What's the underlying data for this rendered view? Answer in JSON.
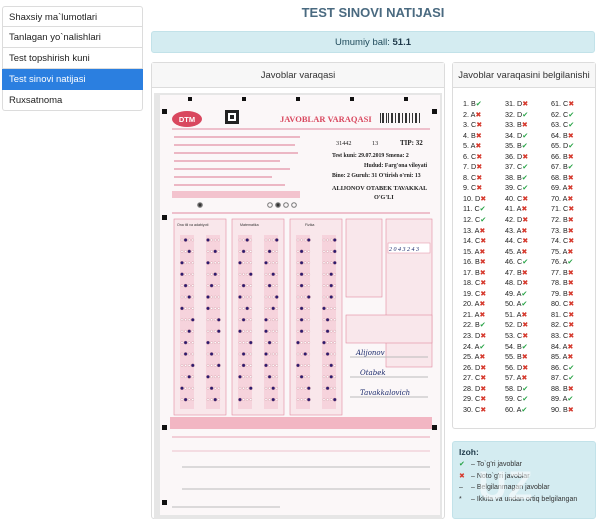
{
  "sidebar": {
    "items": [
      {
        "label": "Shaxsiy ma`lumotlari",
        "active": false
      },
      {
        "label": "Tanlagan yo`nalishlari",
        "active": false
      },
      {
        "label": "Test topshirish kuni",
        "active": false
      },
      {
        "label": "Test sinovi natijasi",
        "active": true
      },
      {
        "label": "Ruxsatnoma",
        "active": false
      }
    ]
  },
  "page_title": "TEST SINOVI NATIJASI",
  "score": {
    "label": "Umumiy ball:",
    "value": "51.1"
  },
  "sheet_panel": {
    "title": "Javoblar varaqasi",
    "sheet": {
      "logo": "DTM",
      "heading": "JAVOBLAR VARAQASI",
      "id_number": "31442",
      "variant": "13",
      "tip": "TIP: 32",
      "test_date_label": "Test kuni:",
      "test_date": "29.07.2019",
      "shift_label": "Smena:",
      "shift": "2",
      "region_label": "Hudud:",
      "region": "Farg'ona viloyati",
      "building_label": "Bino:",
      "building": "2",
      "group_label": "Guruh:",
      "group": "31",
      "seat_label": "O'tirish o'rni:",
      "seat": "13",
      "name_line1": "ALIJONOV OTABEK TAVAKKAL",
      "name_line2": "O'G'LI",
      "subjects": [
        "Ona tili va adabiyoti",
        "Matematika",
        "Fizika"
      ],
      "handwritten": [
        "Alijonov",
        "Otabek",
        "Tavakkalovich"
      ],
      "written_code": "2 0 4 3 2 4 3"
    }
  },
  "key_panel": {
    "title": "Javoblar varaqasini belgilanishi",
    "answers": [
      {
        "n": "1.",
        "l": "B",
        "m": "ok"
      },
      {
        "n": "2.",
        "l": "A",
        "m": "x"
      },
      {
        "n": "3.",
        "l": "C",
        "m": "x"
      },
      {
        "n": "4.",
        "l": "B",
        "m": "x"
      },
      {
        "n": "5.",
        "l": "A",
        "m": "x"
      },
      {
        "n": "6.",
        "l": "C",
        "m": "x"
      },
      {
        "n": "7.",
        "l": "D",
        "m": "x"
      },
      {
        "n": "8.",
        "l": "C",
        "m": "x"
      },
      {
        "n": "9.",
        "l": "C",
        "m": "x"
      },
      {
        "n": "10.",
        "l": "D",
        "m": "x"
      },
      {
        "n": "11.",
        "l": "C",
        "m": "ok"
      },
      {
        "n": "12.",
        "l": "C",
        "m": "ok"
      },
      {
        "n": "13.",
        "l": "A",
        "m": "x"
      },
      {
        "n": "14.",
        "l": "C",
        "m": "x"
      },
      {
        "n": "15.",
        "l": "A",
        "m": "x"
      },
      {
        "n": "16.",
        "l": "B",
        "m": "x"
      },
      {
        "n": "17.",
        "l": "B",
        "m": "x"
      },
      {
        "n": "18.",
        "l": "C",
        "m": "x"
      },
      {
        "n": "19.",
        "l": "C",
        "m": "x"
      },
      {
        "n": "20.",
        "l": "A",
        "m": "x"
      },
      {
        "n": "21.",
        "l": "A",
        "m": "x"
      },
      {
        "n": "22.",
        "l": "B",
        "m": "ok"
      },
      {
        "n": "23.",
        "l": "D",
        "m": "x"
      },
      {
        "n": "24.",
        "l": "A",
        "m": "ok"
      },
      {
        "n": "25.",
        "l": "A",
        "m": "x"
      },
      {
        "n": "26.",
        "l": "D",
        "m": "x"
      },
      {
        "n": "27.",
        "l": "C",
        "m": "x"
      },
      {
        "n": "28.",
        "l": "D",
        "m": "x"
      },
      {
        "n": "29.",
        "l": "C",
        "m": "x"
      },
      {
        "n": "30.",
        "l": "C",
        "m": "x"
      },
      {
        "n": "31.",
        "l": "D",
        "m": "x"
      },
      {
        "n": "32.",
        "l": "D",
        "m": "ok"
      },
      {
        "n": "33.",
        "l": "B",
        "m": "x"
      },
      {
        "n": "34.",
        "l": "D",
        "m": "ok"
      },
      {
        "n": "35.",
        "l": "B",
        "m": "ok"
      },
      {
        "n": "36.",
        "l": "D",
        "m": "x"
      },
      {
        "n": "37.",
        "l": "C",
        "m": "ok"
      },
      {
        "n": "38.",
        "l": "B",
        "m": "ok"
      },
      {
        "n": "39.",
        "l": "C",
        "m": "ok"
      },
      {
        "n": "40.",
        "l": "C",
        "m": "x"
      },
      {
        "n": "41.",
        "l": "A",
        "m": "x"
      },
      {
        "n": "42.",
        "l": "D",
        "m": "x"
      },
      {
        "n": "43.",
        "l": "A",
        "m": "x"
      },
      {
        "n": "44.",
        "l": "C",
        "m": "x"
      },
      {
        "n": "45.",
        "l": "A",
        "m": "x"
      },
      {
        "n": "46.",
        "l": "C",
        "m": "ok"
      },
      {
        "n": "47.",
        "l": "B",
        "m": "x"
      },
      {
        "n": "48.",
        "l": "D",
        "m": "x"
      },
      {
        "n": "49.",
        "l": "A",
        "m": "ok"
      },
      {
        "n": "50.",
        "l": "A",
        "m": "ok"
      },
      {
        "n": "51.",
        "l": "A",
        "m": "x"
      },
      {
        "n": "52.",
        "l": "D",
        "m": "x"
      },
      {
        "n": "53.",
        "l": "C",
        "m": "x"
      },
      {
        "n": "54.",
        "l": "B",
        "m": "ok"
      },
      {
        "n": "55.",
        "l": "B",
        "m": "x"
      },
      {
        "n": "56.",
        "l": "D",
        "m": "x"
      },
      {
        "n": "57.",
        "l": "A",
        "m": "x"
      },
      {
        "n": "58.",
        "l": "D",
        "m": "ok"
      },
      {
        "n": "59.",
        "l": "C",
        "m": "ok"
      },
      {
        "n": "60.",
        "l": "A",
        "m": "ok"
      },
      {
        "n": "61.",
        "l": "C",
        "m": "x"
      },
      {
        "n": "62.",
        "l": "C",
        "m": "ok"
      },
      {
        "n": "63.",
        "l": "C",
        "m": "ok"
      },
      {
        "n": "64.",
        "l": "B",
        "m": "x"
      },
      {
        "n": "65.",
        "l": "D",
        "m": "ok"
      },
      {
        "n": "66.",
        "l": "B",
        "m": "x"
      },
      {
        "n": "67.",
        "l": "B",
        "m": "ok"
      },
      {
        "n": "68.",
        "l": "B",
        "m": "x"
      },
      {
        "n": "69.",
        "l": "A",
        "m": "x"
      },
      {
        "n": "70.",
        "l": "A",
        "m": "x"
      },
      {
        "n": "71.",
        "l": "C",
        "m": "x"
      },
      {
        "n": "72.",
        "l": "B",
        "m": "x"
      },
      {
        "n": "73.",
        "l": "B",
        "m": "x"
      },
      {
        "n": "74.",
        "l": "C",
        "m": "x"
      },
      {
        "n": "75.",
        "l": "A",
        "m": "x"
      },
      {
        "n": "76.",
        "l": "A",
        "m": "ok"
      },
      {
        "n": "77.",
        "l": "B",
        "m": "x"
      },
      {
        "n": "78.",
        "l": "B",
        "m": "x"
      },
      {
        "n": "79.",
        "l": "B",
        "m": "x"
      },
      {
        "n": "80.",
        "l": "C",
        "m": "x"
      },
      {
        "n": "81.",
        "l": "C",
        "m": "x"
      },
      {
        "n": "82.",
        "l": "C",
        "m": "x"
      },
      {
        "n": "83.",
        "l": "C",
        "m": "x"
      },
      {
        "n": "84.",
        "l": "A",
        "m": "x"
      },
      {
        "n": "85.",
        "l": "A",
        "m": "x"
      },
      {
        "n": "86.",
        "l": "C",
        "m": "ok"
      },
      {
        "n": "87.",
        "l": "C",
        "m": "ok"
      },
      {
        "n": "88.",
        "l": "B",
        "m": "x"
      },
      {
        "n": "89.",
        "l": "A",
        "m": "ok"
      },
      {
        "n": "90.",
        "l": "B",
        "m": "x"
      }
    ]
  },
  "legend": {
    "title": "Izoh:",
    "items": [
      {
        "symbol": "✔",
        "color": "#25a244",
        "text": "– To`g'ri javoblar"
      },
      {
        "symbol": "✖",
        "color": "#d63a2e",
        "text": "– Noto`g'ri javoblar"
      },
      {
        "symbol": "–",
        "color": "#333333",
        "text": "– Belgilanmagan javoblar"
      },
      {
        "symbol": "*",
        "color": "#333333",
        "text": "– Ikkita va undan ortiq belgilangan"
      }
    ]
  },
  "watermark": "UZ",
  "colors": {
    "accent": "#2b7fe0",
    "info_bg": "#d4ecf1",
    "correct": "#25a244",
    "wrong": "#d63a2e",
    "sheet_pink": "#e9a3b2"
  }
}
